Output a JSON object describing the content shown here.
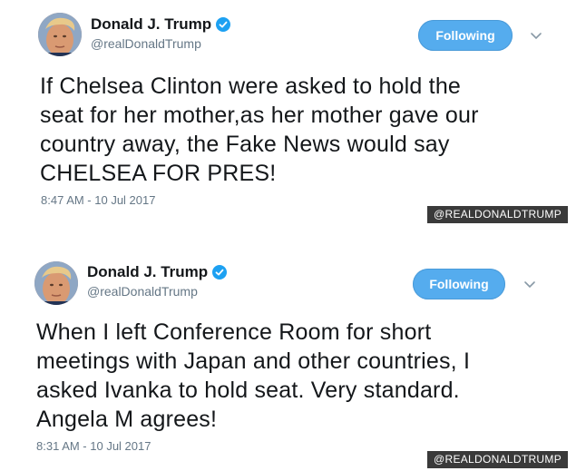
{
  "tweets": [
    {
      "display_name": "Donald J. Trump",
      "handle": "@realDonaldTrump",
      "follow_label": "Following",
      "text": "If Chelsea Clinton were asked to hold the\nseat for her mother,as her mother gave our\ncountry away, the Fake News would say\nCHELSEA FOR PRES!",
      "timestamp": "8:47 AM - 10 Jul 2017",
      "watermark": "@REALDONALDTRUMP",
      "avatar_icon": "profile-photo",
      "verified_icon": "verified-badge-icon"
    },
    {
      "display_name": "Donald J. Trump",
      "handle": "@realDonaldTrump",
      "follow_label": "Following",
      "text": "When I left Conference Room for short\nmeetings with Japan and other countries, I\nasked Ivanka to hold seat. Very standard.\nAngela M agrees!",
      "timestamp": "8:31 AM - 10 Jul 2017",
      "watermark": "@REALDONALDTRUMP",
      "avatar_icon": "profile-photo",
      "verified_icon": "verified-badge-icon"
    }
  ],
  "colors": {
    "accent": "#55acee",
    "verified": "#1da1f2",
    "text": "#14171a",
    "muted": "#657786",
    "watermark_bg": "#3a3a3a"
  }
}
